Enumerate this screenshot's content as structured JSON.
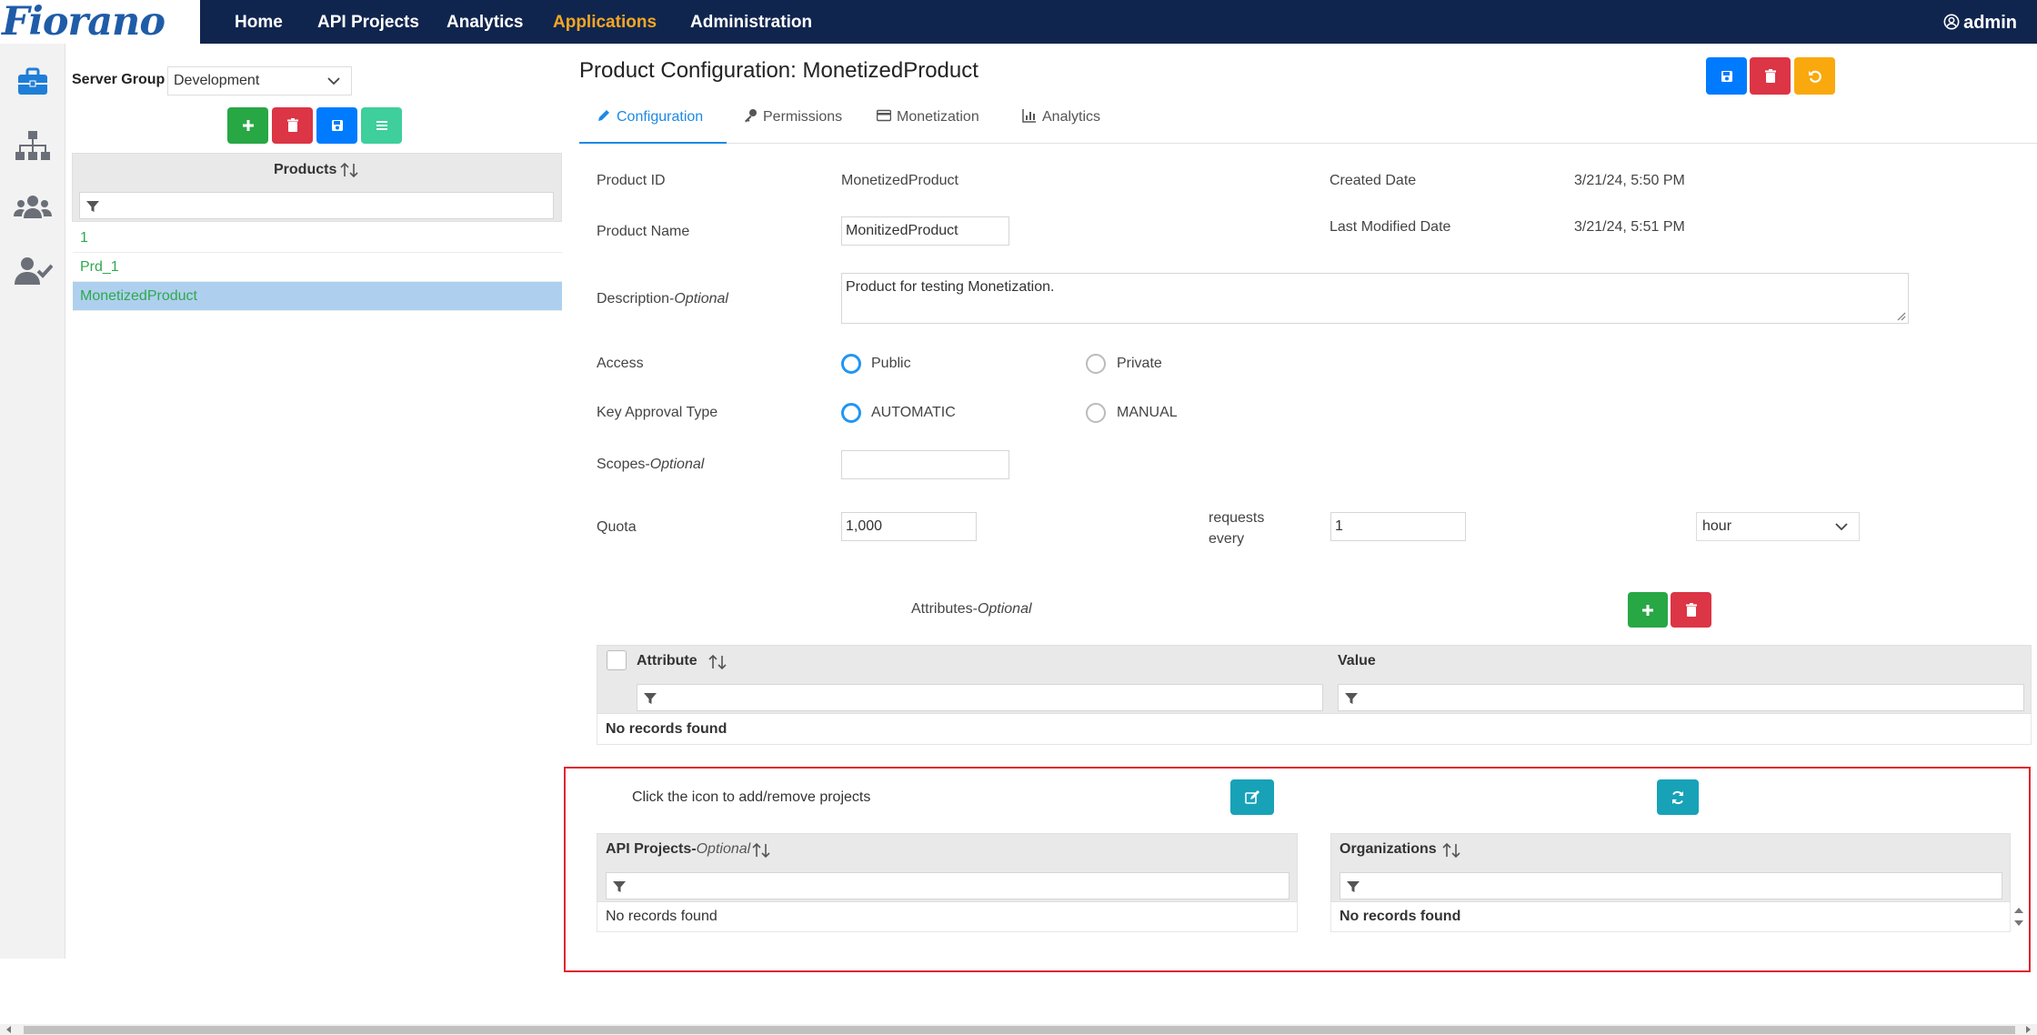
{
  "app": {
    "logo": "Fiorano",
    "nav": [
      "Home",
      "API Projects",
      "Analytics",
      "Applications",
      "Administration"
    ],
    "active_nav": "Applications",
    "user": "admin"
  },
  "left_panel": {
    "server_group_label": "Server Group",
    "server_group_value": "Development",
    "products_header": "Products",
    "products": [
      "1",
      "Prd_1",
      "MonetizedProduct"
    ],
    "selected_product": "MonetizedProduct"
  },
  "page": {
    "title": "Product Configuration: MonetizedProduct",
    "tabs": [
      "Configuration",
      "Permissions",
      "Monetization",
      "Analytics"
    ],
    "active_tab": "Configuration"
  },
  "form": {
    "product_id_label": "Product ID",
    "product_id": "MonetizedProduct",
    "created_date_label": "Created Date",
    "created_date": "3/21/24, 5:50 PM",
    "product_name_label": "Product Name",
    "product_name": "MonitizedProduct",
    "last_modified_label": "Last Modified Date",
    "last_modified": "3/21/24, 5:51 PM",
    "description_label": "Description-",
    "description_optional": "Optional",
    "description": "Product for testing Monetization.",
    "access_label": "Access",
    "access_options": [
      "Public",
      "Private"
    ],
    "access_selected": "Public",
    "key_approval_label": "Key Approval Type",
    "key_approval_options": [
      "AUTOMATIC",
      "MANUAL"
    ],
    "key_approval_selected": "AUTOMATIC",
    "scopes_label": "Scopes-",
    "scopes_optional": "Optional",
    "scopes": "",
    "quota_label": "Quota",
    "quota": "1,000",
    "requests_every_1": "requests",
    "requests_every_2": "every",
    "quota_interval": "1",
    "quota_unit": "hour"
  },
  "attributes": {
    "label": "Attributes-",
    "optional": "Optional",
    "columns": [
      "Attribute",
      "Value"
    ],
    "empty": "No records found"
  },
  "projects": {
    "hint": "Click the icon to add/remove projects",
    "api_projects_label": "API Projects-",
    "api_projects_optional": "Optional",
    "api_projects_empty": "No records found",
    "organizations_label": "Organizations",
    "organizations_empty": "No records found"
  },
  "colors": {
    "navbar": "#10254e",
    "accent": "#f5a623",
    "link_green": "#2fa84f",
    "selection": "#aed0ee",
    "highlight_border": "#e0262f"
  }
}
